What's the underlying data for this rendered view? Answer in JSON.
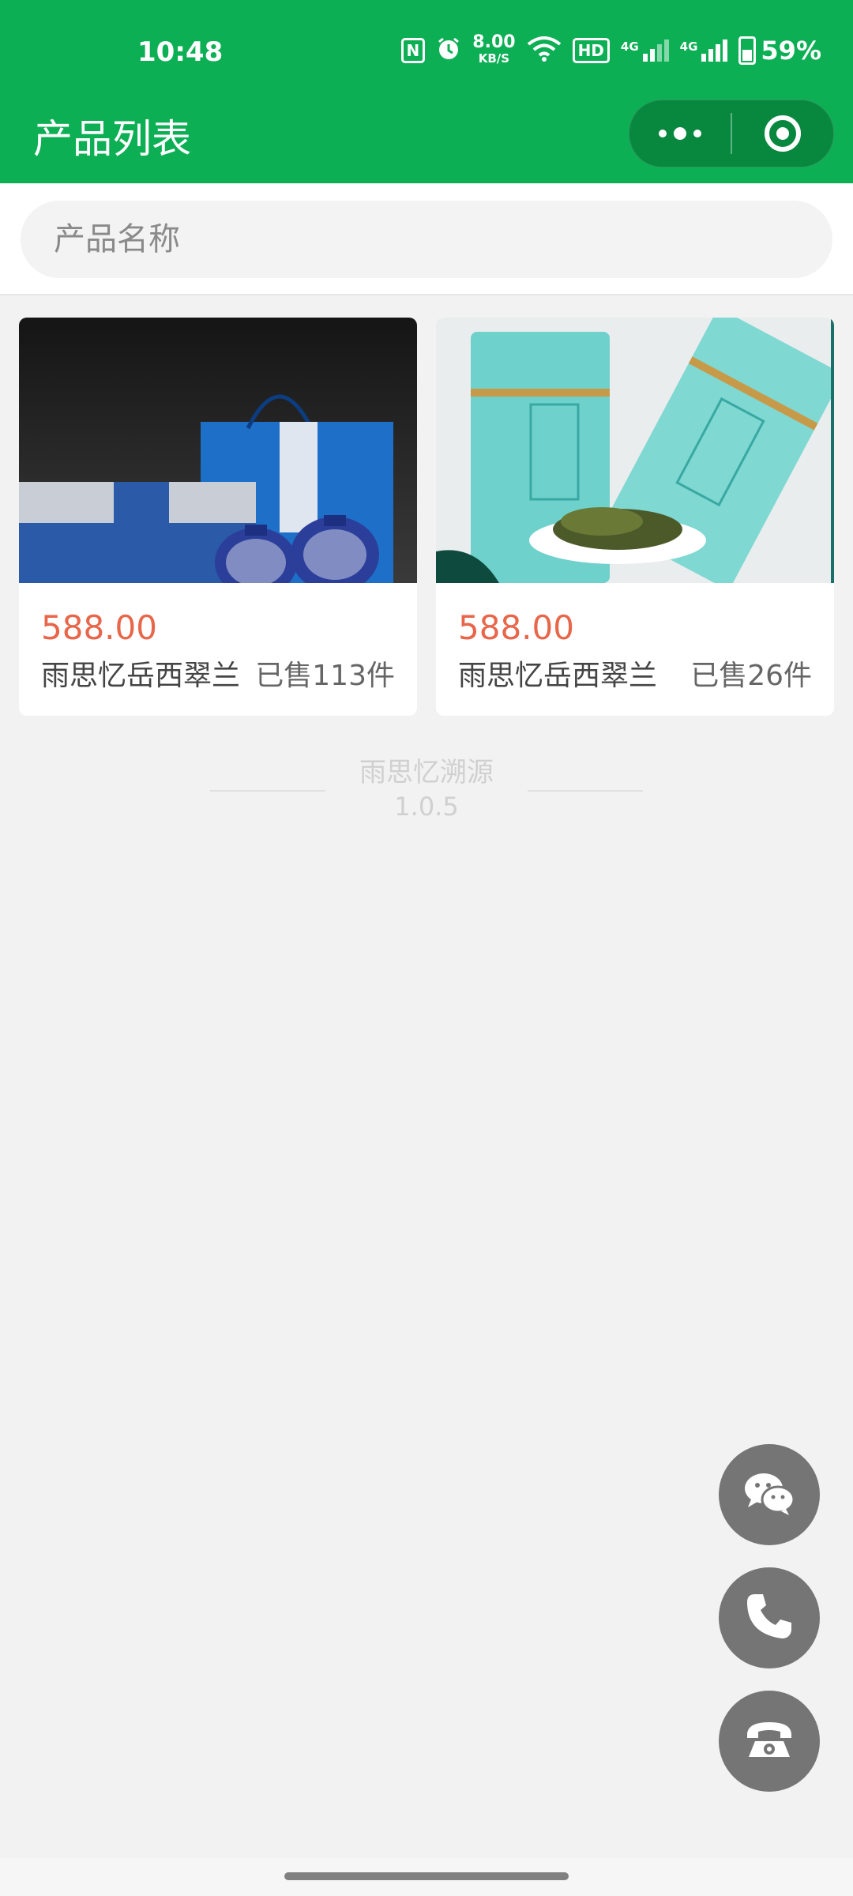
{
  "status_bar": {
    "time": "10:48",
    "nfc_label": "N",
    "net_speed_value": "8.00",
    "net_speed_unit": "KB/S",
    "hd_label": "HD",
    "sim1_type": "4G",
    "sim2_type": "4G",
    "battery": "59%"
  },
  "nav": {
    "title": "产品列表"
  },
  "search": {
    "placeholder": "产品名称",
    "value": ""
  },
  "products": [
    {
      "price": "588.00",
      "name": "雨思忆岳西翠兰",
      "sold": "已售113件"
    },
    {
      "price": "588.00",
      "name": "雨思忆岳西翠兰",
      "sold": "已售26件"
    }
  ],
  "footer": {
    "brand": "雨思忆溯源",
    "version": "1.0.5"
  },
  "floating_buttons": [
    {
      "icon": "wechat-icon"
    },
    {
      "icon": "phone-icon"
    },
    {
      "icon": "telephone-icon"
    }
  ],
  "colors": {
    "brand_green": "#0daf55",
    "price_orange": "#e8664a",
    "fab_gray": "#757575"
  }
}
